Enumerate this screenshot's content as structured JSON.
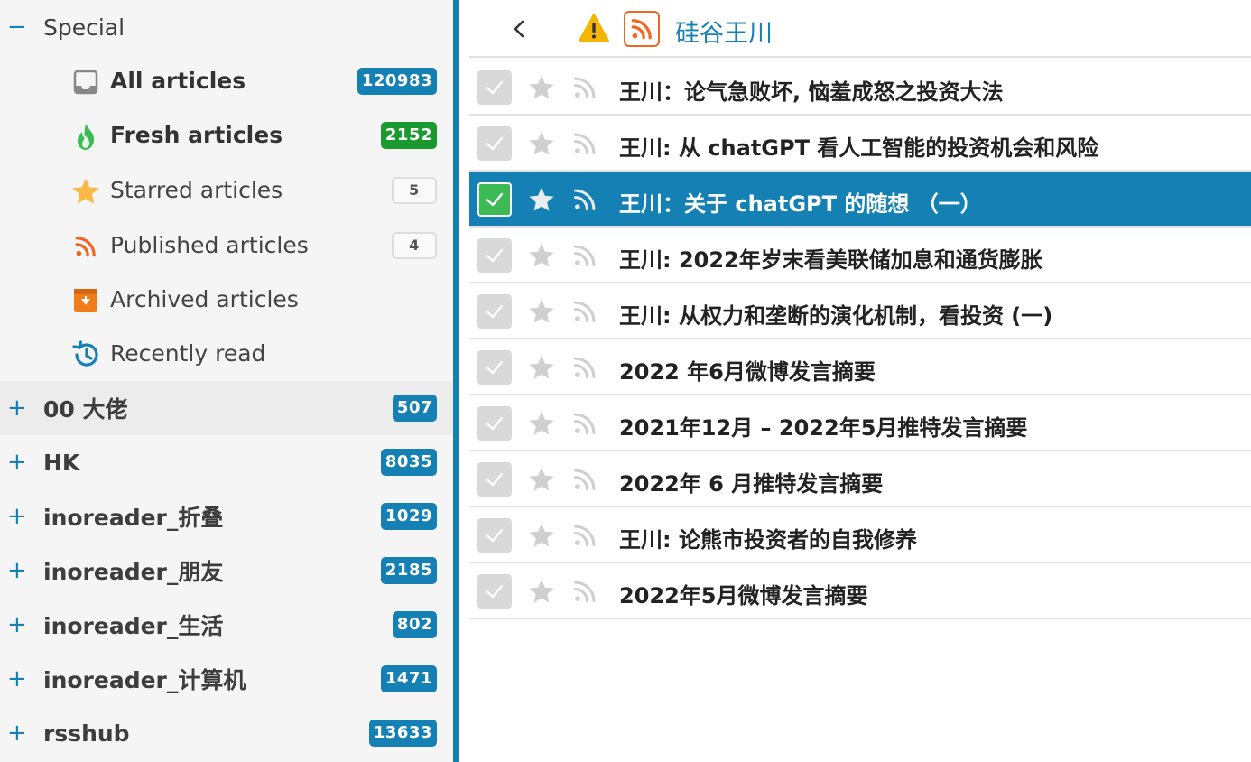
{
  "sidebar": {
    "special": {
      "toggle": "−",
      "title": "Special",
      "feeds": [
        {
          "label": "All articles",
          "count": "120983",
          "icon": "inbox-icon",
          "bold": true
        },
        {
          "label": "Fresh articles",
          "count": "2152",
          "icon": "flame-icon",
          "bold": true
        },
        {
          "label": "Starred articles",
          "count": "5",
          "icon": "star-icon",
          "bold": false
        },
        {
          "label": "Published articles",
          "count": "4",
          "icon": "rss-icon",
          "bold": false
        },
        {
          "label": "Archived articles",
          "count": "",
          "icon": "archive-icon",
          "bold": false
        },
        {
          "label": "Recently read",
          "count": "",
          "icon": "history-icon",
          "bold": false
        }
      ]
    },
    "categories": [
      {
        "toggle": "+",
        "title": "00 大佬",
        "count": "507"
      },
      {
        "toggle": "+",
        "title": "HK",
        "count": "8035"
      },
      {
        "toggle": "+",
        "title": "inoreader_折叠",
        "count": "1029"
      },
      {
        "toggle": "+",
        "title": "inoreader_朋友",
        "count": "2185"
      },
      {
        "toggle": "+",
        "title": "inoreader_生活",
        "count": "802"
      },
      {
        "toggle": "+",
        "title": "inoreader_计算机",
        "count": "1471"
      },
      {
        "toggle": "+",
        "title": "rsshub",
        "count": "13633"
      }
    ]
  },
  "header": {
    "feed_name": "硅谷王川",
    "icons": [
      "back-chevron-icon",
      "warning-icon",
      "rss-icon"
    ]
  },
  "articles": [
    {
      "title": "王川：论气急败坏, 恼羞成怒之投资大法",
      "active": false
    },
    {
      "title": "王川: 从 chatGPT 看人工智能的投资机会和风险",
      "active": false
    },
    {
      "title": "王川：关于 chatGPT 的随想 （一）",
      "active": true
    },
    {
      "title": "王川: 2022年岁末看美联储加息和通货膨胀",
      "active": false
    },
    {
      "title": "王川: 从权力和垄断的演化机制，看投资 (一)",
      "active": false
    },
    {
      "title": "2022 年6月微博发言摘要",
      "active": false
    },
    {
      "title": "2021年12月 – 2022年5月推特发言摘要",
      "active": false
    },
    {
      "title": "2022年 6 月推特发言摘要",
      "active": false
    },
    {
      "title": "王川: 论熊市投资者的自我修养",
      "active": false
    },
    {
      "title": "2022年5月微博发言摘要",
      "active": false
    }
  ],
  "colors": {
    "accent": "#1580b3",
    "fresh": "#1a9a2e",
    "rss": "#f26522",
    "warning": "#f5b400"
  }
}
